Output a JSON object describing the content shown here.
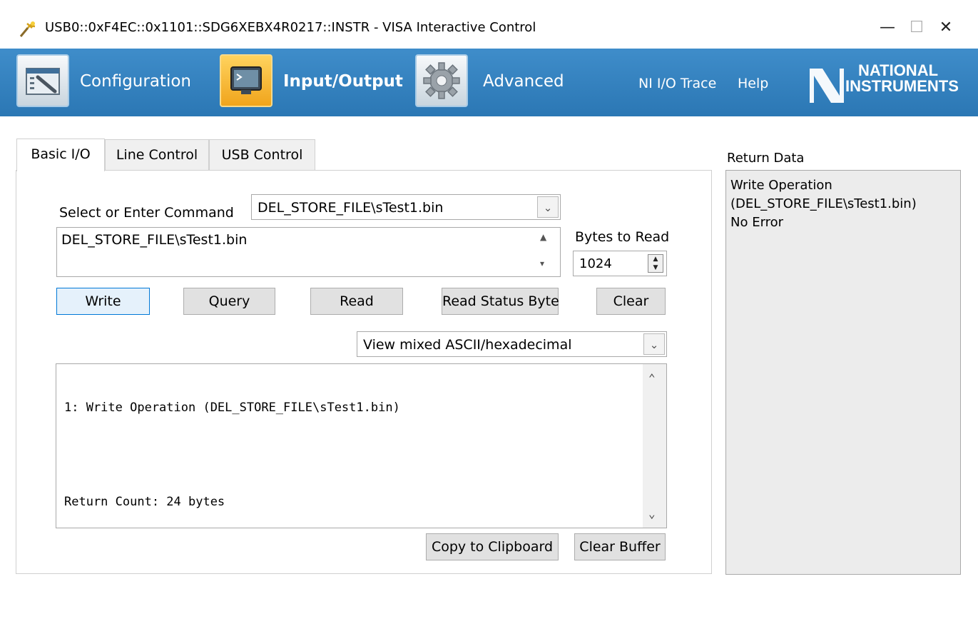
{
  "window": {
    "title": "USB0::0xF4EC::0x1101::SDG6XEBX4R0217::INSTR - VISA Interactive Control",
    "minimize_glyph": "—",
    "maximize_glyph": "☐",
    "close_glyph": "✕"
  },
  "toolbar": {
    "configuration_label": "Configuration",
    "io_label": "Input/Output",
    "advanced_label": "Advanced",
    "trace_link": "NI I/O Trace",
    "help_link": "Help",
    "logo_line1": "NATIONAL",
    "logo_line2": "INSTRUMENTS",
    "accent": "#2f7fbd"
  },
  "tabs": [
    {
      "label": "Basic I/O",
      "active": true
    },
    {
      "label": "Line Control",
      "active": false
    },
    {
      "label": "USB Control",
      "active": false
    }
  ],
  "basic_io": {
    "command_label": "Select or Enter Command",
    "command_selected": "DEL_STORE_FILE\\sTest1.bin",
    "command_text": "DEL_STORE_FILE\\sTest1.bin",
    "bytes_label": "Bytes to Read",
    "bytes_value": "1024",
    "buttons": {
      "write": "Write",
      "query": "Query",
      "read": "Read",
      "read_status": "Read Status Byte",
      "clear": "Clear",
      "copy": "Copy to Clipboard",
      "clear_buffer": "Clear Buffer"
    },
    "view_mode": "View mixed ASCII/hexadecimal",
    "output_lines": [
      "1: Write Operation (DEL_STORE_FILE\\sTest1.bin)",
      "",
      "Return Count: 24 bytes"
    ]
  },
  "return_data": {
    "label": "Return Data",
    "lines": [
      "Write Operation",
      "(DEL_STORE_FILE\\sTest1.bin)",
      "No Error"
    ]
  }
}
